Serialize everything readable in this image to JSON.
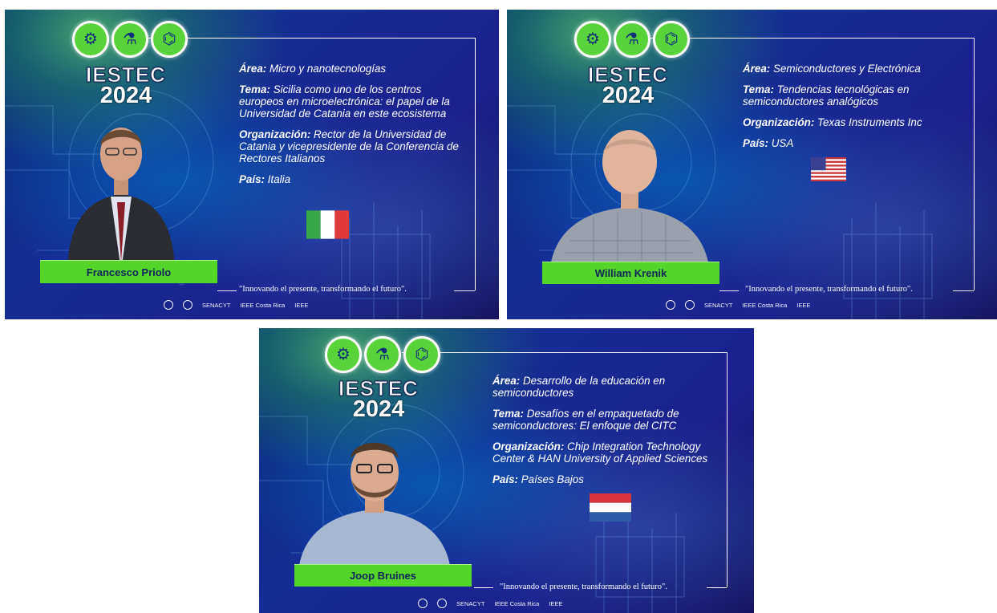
{
  "logo": {
    "line1": "IESTEC",
    "line2": "2024"
  },
  "badge_icons": [
    "gear-icon",
    "lab-flask-icon",
    "circuit-icon"
  ],
  "slogan": "\"Innovando el presente, transformando el futuro\".",
  "sponsors": [
    "SENACYT",
    "IEEE Costa Rica",
    "IEEE"
  ],
  "labels": {
    "area": "Área:",
    "tema": "Tema:",
    "organizacion": "Organización:",
    "pais": "País:"
  },
  "speakers": [
    {
      "name": "Francesco Priolo",
      "area": "Micro y nanotecnologías",
      "tema": "Sicilia como uno de los centros europeos en microelectrónica: el papel de la Universidad de Catania en este ecosistema",
      "organizacion": "Rector de la Universidad de Catania y vicepresidente de la Conferencia de Rectores Italianos",
      "pais": "Italia",
      "flag": "italy-flag"
    },
    {
      "name": "William Krenik",
      "area": "Semiconductores y Electrónica",
      "tema": "Tendencias tecnológicas en semiconductores analógicos",
      "organizacion": "Texas Instruments Inc",
      "pais": "USA",
      "flag": "usa-flag"
    },
    {
      "name": "Joop Bruines",
      "area": "Desarrollo de la educación en semiconductores",
      "tema": "Desafíos en el empaquetado de semiconductores: El enfoque del CITC",
      "organizacion": "Chip Integration Technology Center & HAN University of Applied Sciences",
      "pais": "Países Bajos",
      "flag": "netherlands-flag"
    }
  ],
  "colors": {
    "name_bar": "#55d42a",
    "badge": "#5ad23a",
    "background": "#142e95"
  }
}
